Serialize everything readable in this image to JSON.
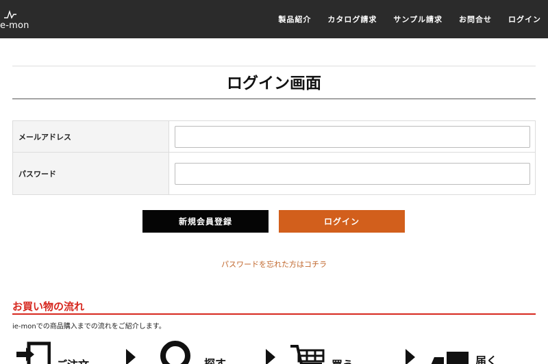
{
  "header": {
    "logo_text": "e-mon",
    "nav": [
      {
        "label": "製品紹介"
      },
      {
        "label": "カタログ請求"
      },
      {
        "label": "サンプル請求"
      },
      {
        "label": "お問合せ"
      },
      {
        "label": "ログイン"
      }
    ]
  },
  "page": {
    "title": "ログイン画面"
  },
  "form": {
    "email_label": "メールアドレス",
    "email_value": "",
    "password_label": "パスワード",
    "password_value": ""
  },
  "buttons": {
    "register_label": "新規会員登録",
    "login_label": "ログイン"
  },
  "links": {
    "forgot_password": "パスワードを忘れた方はコチラ"
  },
  "flow_section": {
    "title": "お買い物の流れ",
    "description": "ie-monでの商品購入までの流れをご紹介します。",
    "steps": [
      {
        "label": "ご注文",
        "icon": "door-icon"
      },
      {
        "label": "探す",
        "icon": "search-icon"
      },
      {
        "label": "買う",
        "icon": "cart-icon"
      },
      {
        "label": "届く",
        "icon": "truck-icon"
      }
    ]
  },
  "colors": {
    "header_bg": "#2b2b2b",
    "accent_orange": "#d25f1c",
    "section_red": "#d6261d"
  }
}
